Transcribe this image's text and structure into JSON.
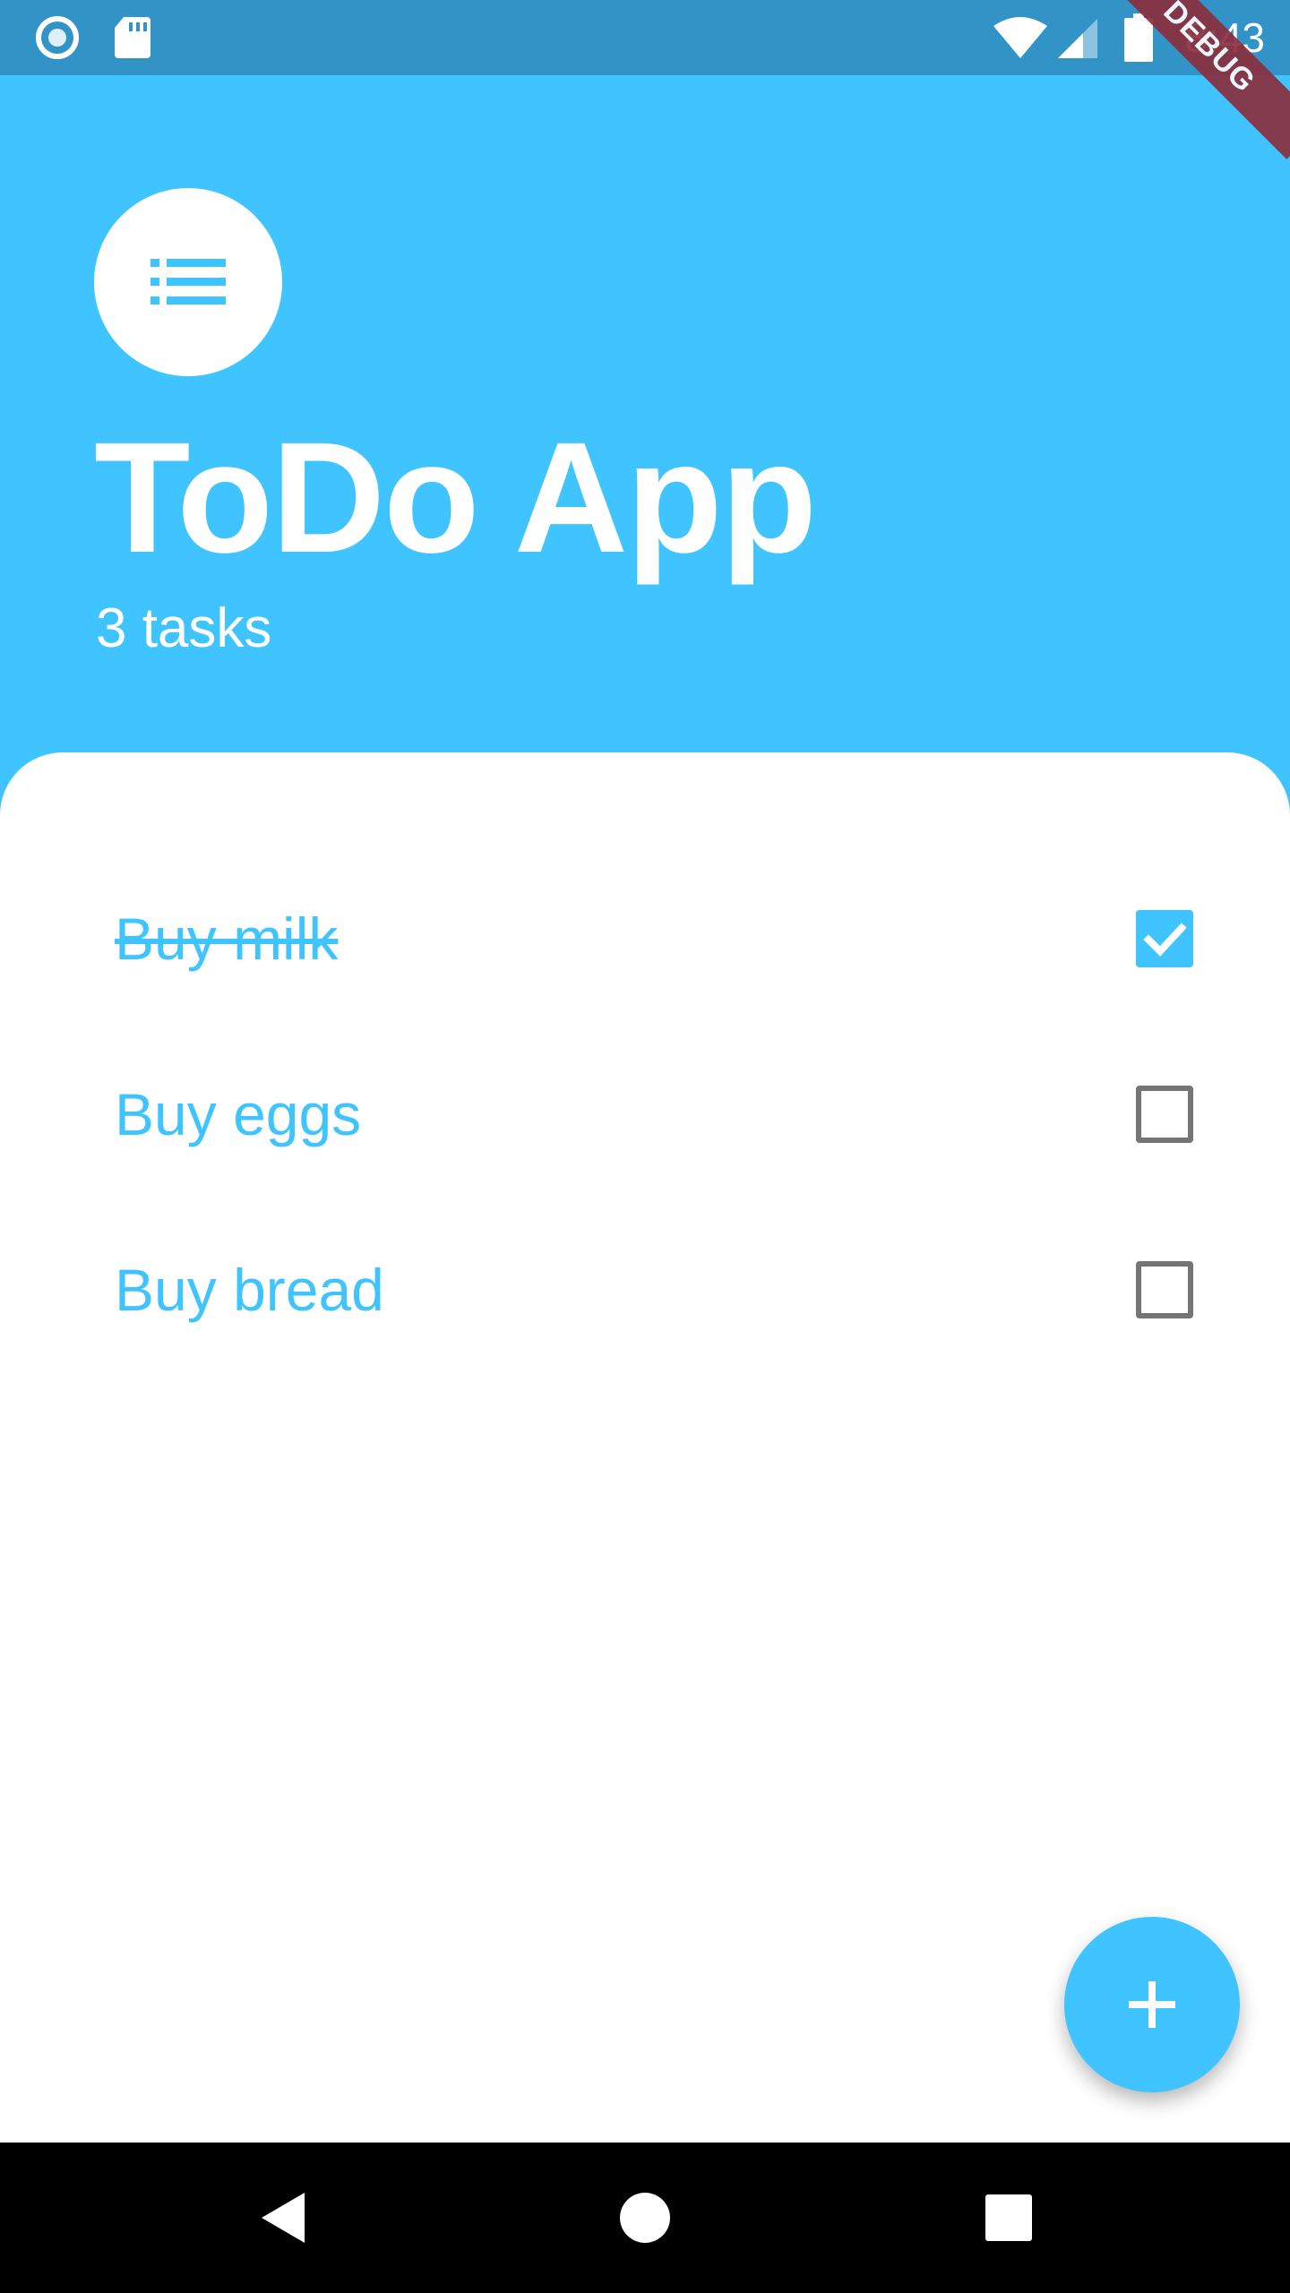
{
  "status_bar": {
    "time": "8:43",
    "icons": [
      "circle-app-icon",
      "sd-card-icon",
      "wifi-icon",
      "signal-icon",
      "battery-icon"
    ]
  },
  "debug_banner": {
    "label": "DEBUG"
  },
  "header": {
    "icon": "list-icon",
    "title": "ToDo App",
    "subtitle": "3 tasks"
  },
  "tasks": [
    {
      "label": "Buy milk",
      "done": true
    },
    {
      "label": "Buy eggs",
      "done": false
    },
    {
      "label": "Buy bread",
      "done": false
    }
  ],
  "fab": {
    "icon": "plus-icon"
  },
  "nav_bar": {
    "icons": [
      "back-icon",
      "home-icon",
      "recents-icon"
    ]
  },
  "colors": {
    "accent": "#40c4ff",
    "status_bar": "#3193c6",
    "debug": "#8b2c3a",
    "checkbox_border": "#757575"
  }
}
